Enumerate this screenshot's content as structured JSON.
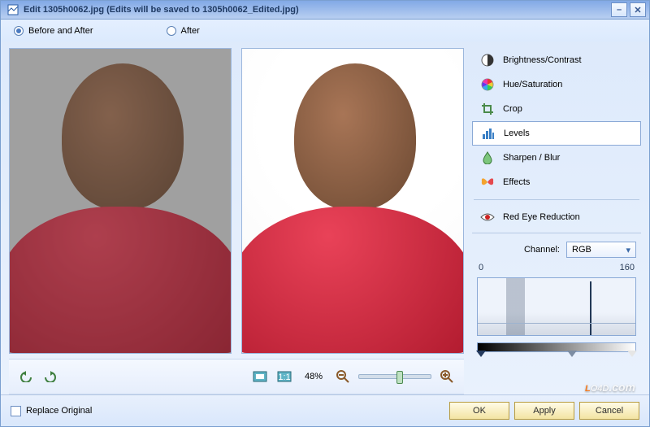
{
  "window": {
    "title": "Edit 1305h0062.jpg  (Edits will be saved to 1305h0062_Edited.jpg)"
  },
  "view_mode": {
    "before_and_after_label": "Before and After",
    "after_label": "After",
    "selected": "before_and_after"
  },
  "toolbar": {
    "zoom_percent": "48%"
  },
  "tools": {
    "items": [
      {
        "label": "Brightness/Contrast"
      },
      {
        "label": "Hue/Saturation"
      },
      {
        "label": "Crop"
      },
      {
        "label": "Levels"
      },
      {
        "label": "Sharpen / Blur"
      },
      {
        "label": "Effects"
      },
      {
        "label": "Red Eye Reduction"
      }
    ],
    "selected_index": 3
  },
  "levels": {
    "channel_label": "Channel:",
    "channel_value": "RGB",
    "scale_min": "0",
    "scale_max": "160"
  },
  "footer": {
    "replace_original_label": "Replace Original",
    "ok_label": "OK",
    "apply_label": "Apply",
    "cancel_label": "Cancel"
  },
  "watermark": {
    "text_prefix": "L",
    "text_rest": "O4D",
    "suffix": ".com"
  }
}
